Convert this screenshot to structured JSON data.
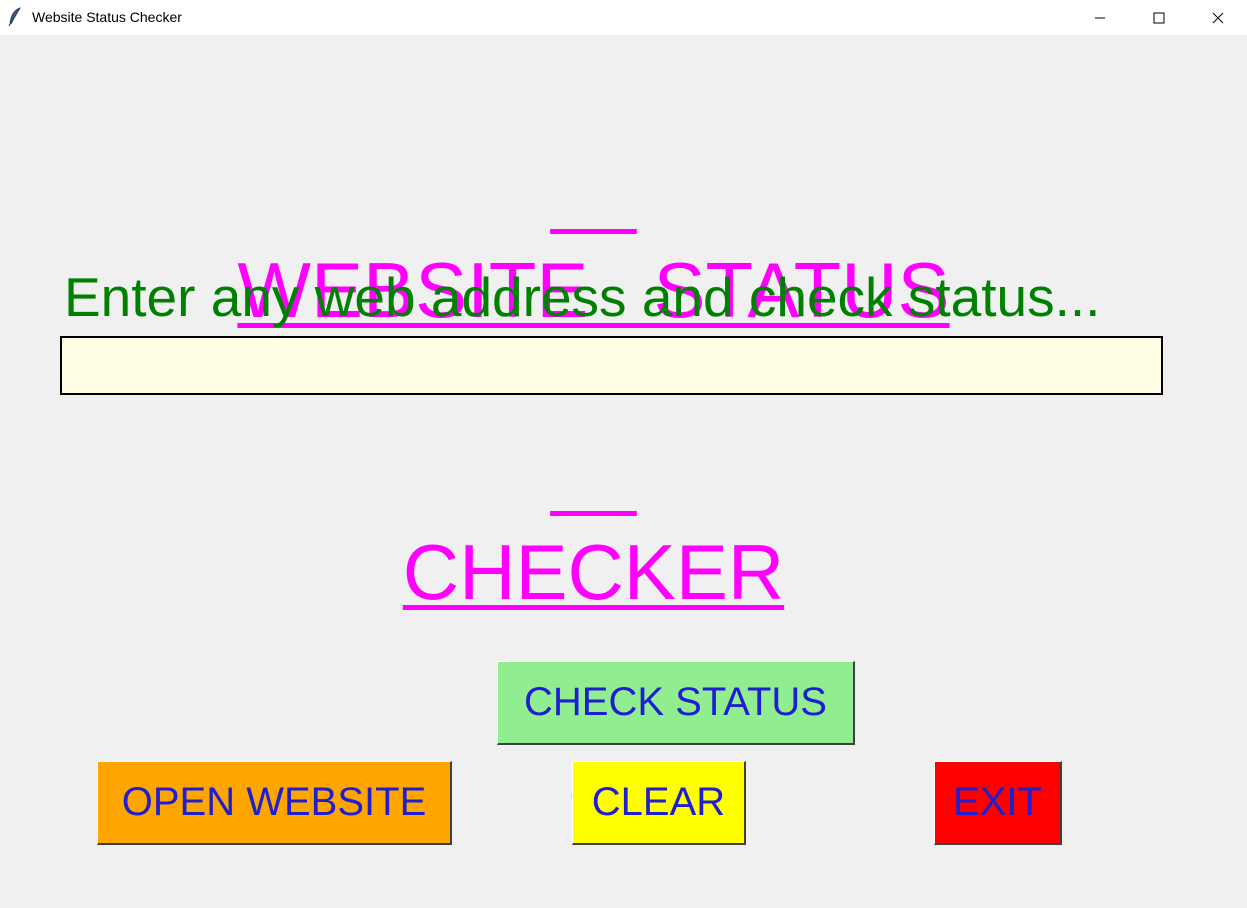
{
  "window": {
    "title": "Website Status Checker",
    "icons": {
      "app": "feather-icon",
      "minimize": "minimize-icon",
      "maximize": "maximize-icon",
      "close": "close-icon"
    }
  },
  "main": {
    "heading_line1": "WEBSITE   STATUS",
    "heading_line2": "CHECKER",
    "prompt": "Enter any web address and check status...",
    "url_input": {
      "value": "",
      "placeholder": ""
    }
  },
  "buttons": {
    "check_status": "CHECK STATUS",
    "open_website": "OPEN WEBSITE",
    "clear": "CLEAR",
    "exit": "EXIT"
  },
  "colors": {
    "heading": "#ff00ff",
    "prompt": "#008000",
    "input_bg": "#fffde3",
    "button_text": "#1f1fd1",
    "check_status_bg": "#90ee90",
    "open_website_bg": "#ffa500",
    "clear_bg": "#ffff00",
    "exit_bg": "#ff0000",
    "window_bg": "#f0f0f0"
  }
}
